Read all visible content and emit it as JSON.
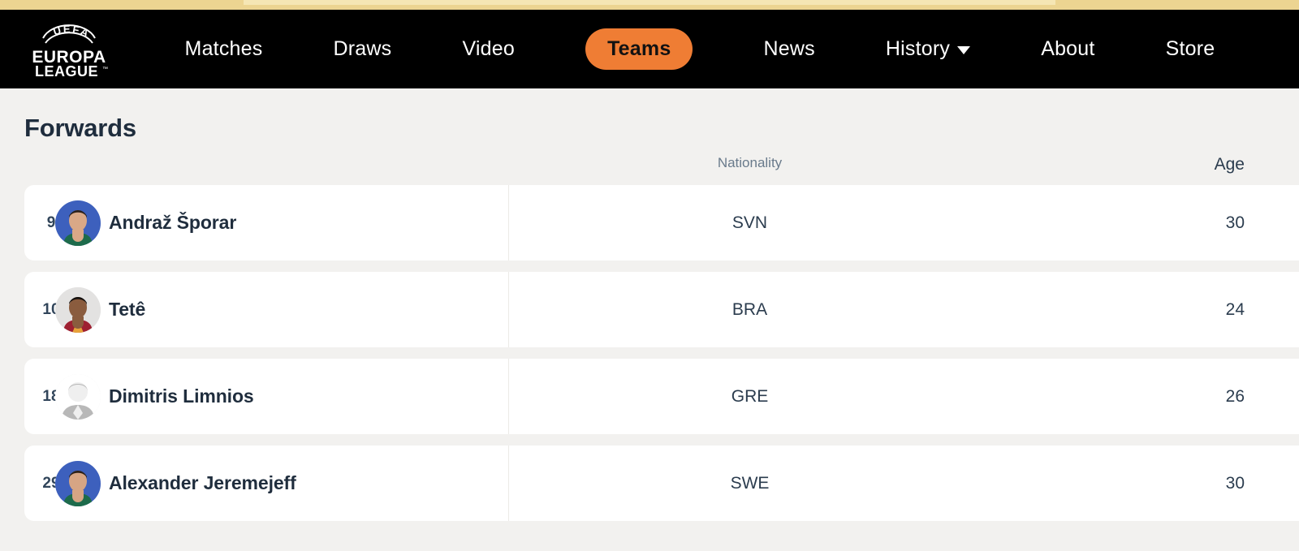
{
  "brand": {
    "logo_line1": "UEFA",
    "logo_line2": "EUROPA",
    "logo_line3": "LEAGUE",
    "logo_tm": "™"
  },
  "nav": {
    "items": [
      {
        "label": "Matches",
        "active": false,
        "has_caret": false
      },
      {
        "label": "Draws",
        "active": false,
        "has_caret": false
      },
      {
        "label": "Video",
        "active": false,
        "has_caret": false
      },
      {
        "label": "Teams",
        "active": true,
        "has_caret": false
      },
      {
        "label": "News",
        "active": false,
        "has_caret": false
      },
      {
        "label": "History",
        "active": false,
        "has_caret": true
      },
      {
        "label": "About",
        "active": false,
        "has_caret": false
      },
      {
        "label": "Store",
        "active": false,
        "has_caret": false
      }
    ],
    "accent_color": "#ef7d34",
    "bar_color": "#000000"
  },
  "section": {
    "title": "Forwards"
  },
  "table": {
    "columns": {
      "nationality": "Nationality",
      "age": "Age"
    },
    "rows": [
      {
        "number": "9",
        "name": "Andraž Šporar",
        "nationality": "SVN",
        "age": "30",
        "avatar": "photo",
        "avatar_bg": "#3d60bd",
        "kit_color": "#1d6b4b",
        "skin": "#d9a887",
        "hair": "#2a201b"
      },
      {
        "number": "10",
        "name": "Tetê",
        "nationality": "BRA",
        "age": "24",
        "avatar": "photo",
        "avatar_bg": "#e3e2e1",
        "kit_color": "#9e2031",
        "kit_color2": "#e8a33a",
        "skin": "#8a5c3e",
        "hair": "#14100e"
      },
      {
        "number": "18",
        "name": "Dimitris Limnios",
        "nationality": "GRE",
        "age": "26",
        "avatar": "placeholder",
        "avatar_bg": "#ffffff",
        "silhouette_color": "#b8b8b8"
      },
      {
        "number": "29",
        "name": "Alexander Jeremejeff",
        "nationality": "SWE",
        "age": "30",
        "avatar": "photo",
        "avatar_bg": "#3d60bd",
        "kit_color": "#1d6b4b",
        "skin": "#d6a584",
        "hair": "#2b2018"
      }
    ]
  },
  "colors": {
    "page_bg": "#f2f1ef",
    "card_bg": "#ffffff",
    "top_strip": "#ecd491",
    "text_dark": "#1f2d3d",
    "text_muted": "#697a8b"
  }
}
